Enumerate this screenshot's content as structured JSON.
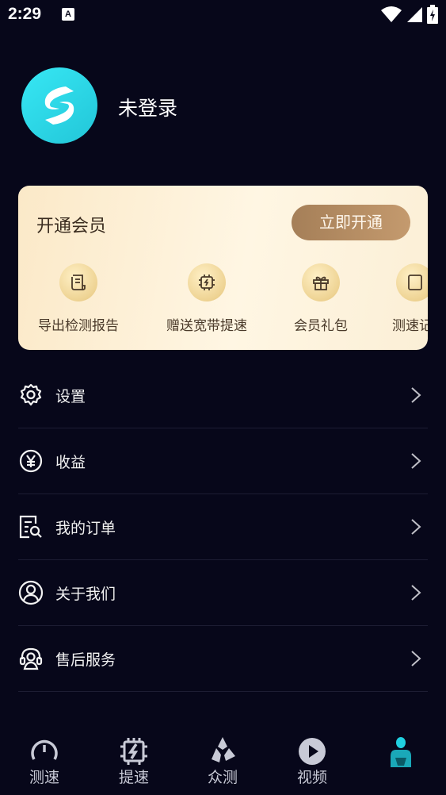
{
  "status_bar": {
    "time": "2:29",
    "a_badge": "A"
  },
  "profile": {
    "username": "未登录"
  },
  "vip": {
    "title": "开通会员",
    "button_label": "立即开通",
    "benefits": [
      {
        "label": "导出检测报告",
        "icon": "report-icon"
      },
      {
        "label": "赠送宽带提速",
        "icon": "chip-icon"
      },
      {
        "label": "会员礼包",
        "icon": "gift-icon"
      },
      {
        "label": "测速记",
        "icon": "record-icon"
      }
    ]
  },
  "menu": [
    {
      "label": "设置",
      "icon": "gear-icon"
    },
    {
      "label": "收益",
      "icon": "yuan-icon"
    },
    {
      "label": "我的订单",
      "icon": "order-icon"
    },
    {
      "label": "关于我们",
      "icon": "person-icon"
    },
    {
      "label": "售后服务",
      "icon": "headset-icon"
    }
  ],
  "bottom_nav": [
    {
      "label": "测速",
      "icon": "gauge-icon"
    },
    {
      "label": "提速",
      "icon": "boost-icon"
    },
    {
      "label": "众测",
      "icon": "crowd-icon"
    },
    {
      "label": "视频",
      "icon": "play-icon"
    },
    {
      "label": "",
      "icon": "profile-icon",
      "active": true
    }
  ],
  "colors": {
    "background": "#07071a",
    "accent": "#1ec8dc",
    "vip_button": "#b08a62"
  }
}
